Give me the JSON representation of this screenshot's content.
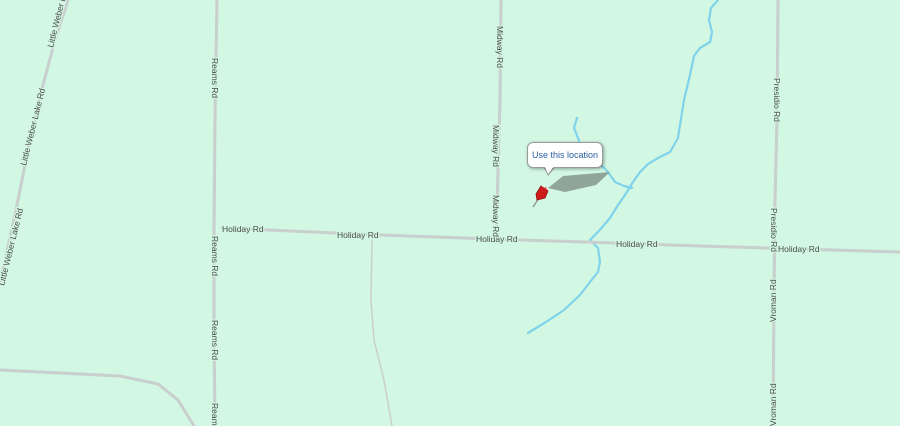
{
  "map": {
    "background_color": "#d2f7e3",
    "road_color": "#c8cfcc",
    "water_color": "#7fd3ea",
    "pin_color": "#d11b1b"
  },
  "roads": {
    "holiday_rd": "Holiday Rd",
    "reams_rd": "Reams Rd",
    "midway_rd": "Midway Rd",
    "presidio_rd": "Presidio Rd",
    "vroman_rd": "Vroman Rd",
    "little_weber_lake_rd": "Little Weber Lake Rd"
  },
  "callout": {
    "label": "Use this location"
  },
  "marker": {
    "icon": "pushpin-icon"
  }
}
